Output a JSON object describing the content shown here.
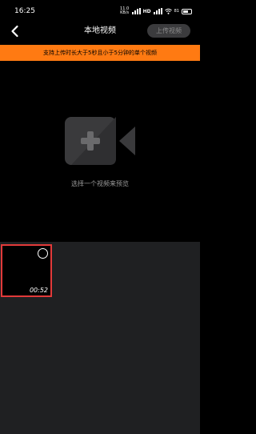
{
  "status": {
    "time": "16:25",
    "net_speed_value": "11.0",
    "net_speed_unit": "KB/s",
    "network": "HD",
    "battery": "81"
  },
  "nav": {
    "title": "本地视频",
    "upload_label": "上传视频"
  },
  "notice": "支持上传时长大于5秒且小于5分钟的单个视频",
  "preview": {
    "hint": "选择一个视频来预览"
  },
  "videos": [
    {
      "duration": "00:52",
      "selected": false
    }
  ],
  "colors": {
    "accent": "#ff7a12",
    "selection_border": "#e23a3a",
    "grid_background": "#1f2022"
  }
}
